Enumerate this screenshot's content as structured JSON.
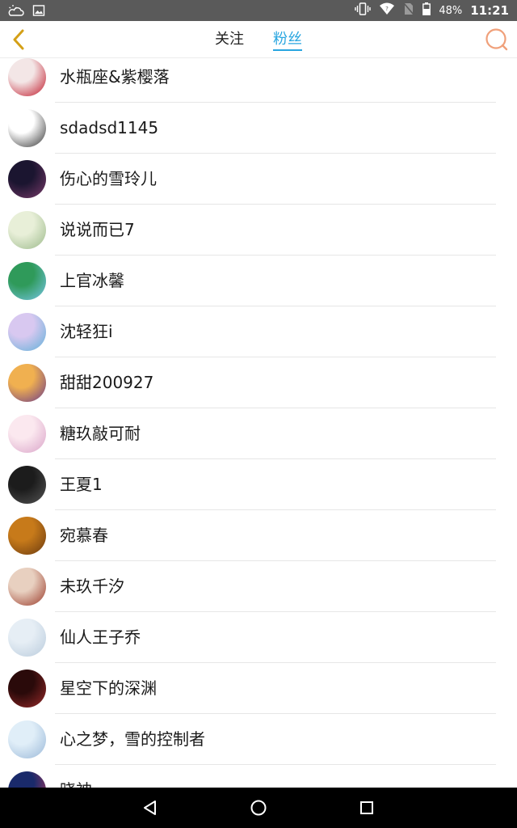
{
  "status_bar": {
    "battery_percent": "48%",
    "time": "11:21",
    "icons": [
      "weather-cloud-icon",
      "image-icon",
      "vibrate-icon",
      "wifi-icon",
      "no-sim-icon",
      "battery-icon"
    ]
  },
  "header": {
    "tabs": [
      {
        "label": "关注",
        "active": false
      },
      {
        "label": "粉丝",
        "active": true
      }
    ],
    "accent_color": "#29a6e0",
    "back_icon_color": "#d4a017",
    "search_icon_color": "#f0a07a"
  },
  "followers": [
    {
      "name": "水瓶座&紫樱落",
      "avatar_colors": [
        "#f3e6e6",
        "#c0182a"
      ]
    },
    {
      "name": "sdadsd1145",
      "avatar_colors": [
        "#ffffff",
        "#333333"
      ]
    },
    {
      "name": "伤心的雪玲儿",
      "avatar_colors": [
        "#1b1530",
        "#7a3a6a"
      ]
    },
    {
      "name": "说说而已7",
      "avatar_colors": [
        "#e8efd8",
        "#9bb98a"
      ]
    },
    {
      "name": "上官冰馨",
      "avatar_colors": [
        "#2f9a5a",
        "#78c6e8"
      ]
    },
    {
      "name": "沈轻狂i",
      "avatar_colors": [
        "#d8c8f0",
        "#5fb0d8"
      ]
    },
    {
      "name": "甜甜200927",
      "avatar_colors": [
        "#f0b050",
        "#6a3a8a"
      ]
    },
    {
      "name": "糖玖敲可耐",
      "avatar_colors": [
        "#fbe8ef",
        "#d9a3c8"
      ]
    },
    {
      "name": "王夏1",
      "avatar_colors": [
        "#1c1c1c",
        "#555555"
      ]
    },
    {
      "name": "宛慕春",
      "avatar_colors": [
        "#c77a1a",
        "#6a3a10"
      ]
    },
    {
      "name": "未玖千汐",
      "avatar_colors": [
        "#e8d0c0",
        "#9a3a2a"
      ]
    },
    {
      "name": "仙人王子乔",
      "avatar_colors": [
        "#e6eef5",
        "#b9cbdc"
      ]
    },
    {
      "name": "星空下的深渊",
      "avatar_colors": [
        "#2a0a0a",
        "#9a2a2a"
      ]
    },
    {
      "name": "心之梦，雪的控制者",
      "avatar_colors": [
        "#e0eef8",
        "#9ab8d8"
      ]
    },
    {
      "name": "晓神",
      "avatar_colors": [
        "#1a2a6a",
        "#c03a5a"
      ]
    }
  ],
  "nav": [
    "back-icon",
    "home-icon",
    "recents-icon"
  ]
}
